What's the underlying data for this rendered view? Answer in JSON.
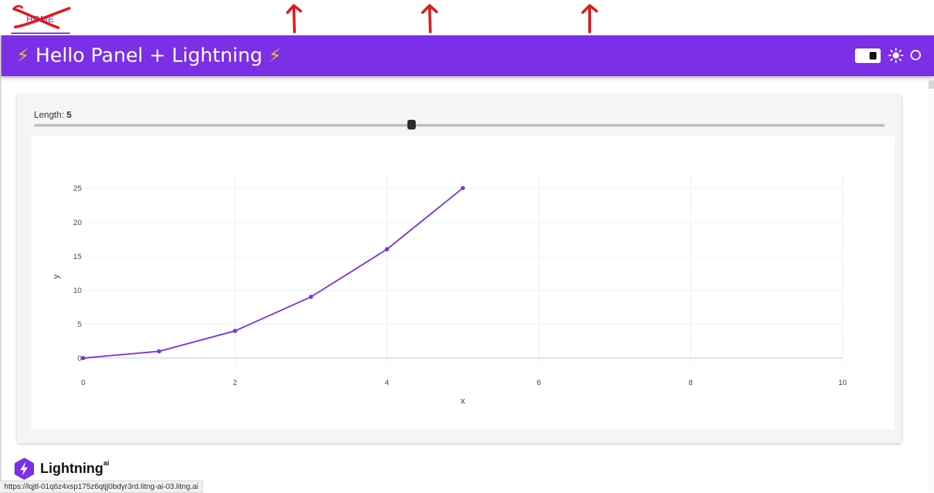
{
  "nav": {
    "home_label": "HOME"
  },
  "header": {
    "title": "Hello Panel + Lightning",
    "bolt": "⚡"
  },
  "slider": {
    "label": "Length:",
    "value": "5",
    "min": 0,
    "max": 10,
    "current": 5
  },
  "chart_data": {
    "type": "line",
    "x": [
      0,
      1,
      2,
      3,
      4,
      5
    ],
    "y": [
      0,
      1,
      4,
      9,
      16,
      25
    ],
    "xlabel": "x",
    "ylabel": "y",
    "xlim": [
      0,
      10
    ],
    "ylim": [
      -1,
      27
    ],
    "xticks": [
      "0",
      "2",
      "4",
      "6",
      "8",
      "10"
    ],
    "yticks": [
      "0",
      "5",
      "10",
      "15",
      "20",
      "25"
    ],
    "grid": true,
    "color": "#7b2fe6"
  },
  "footer": {
    "brand": "Lightning",
    "brand_sup": "ai"
  },
  "status_bar": {
    "url": "https://lqjtl-01q6z4xsp175z6qtjj0bdyr3rd.litng-ai-03.litng.ai"
  },
  "colors": {
    "header": "#7b2fe6",
    "accent": "#7c2be8",
    "annotation": "#e01b1b"
  }
}
